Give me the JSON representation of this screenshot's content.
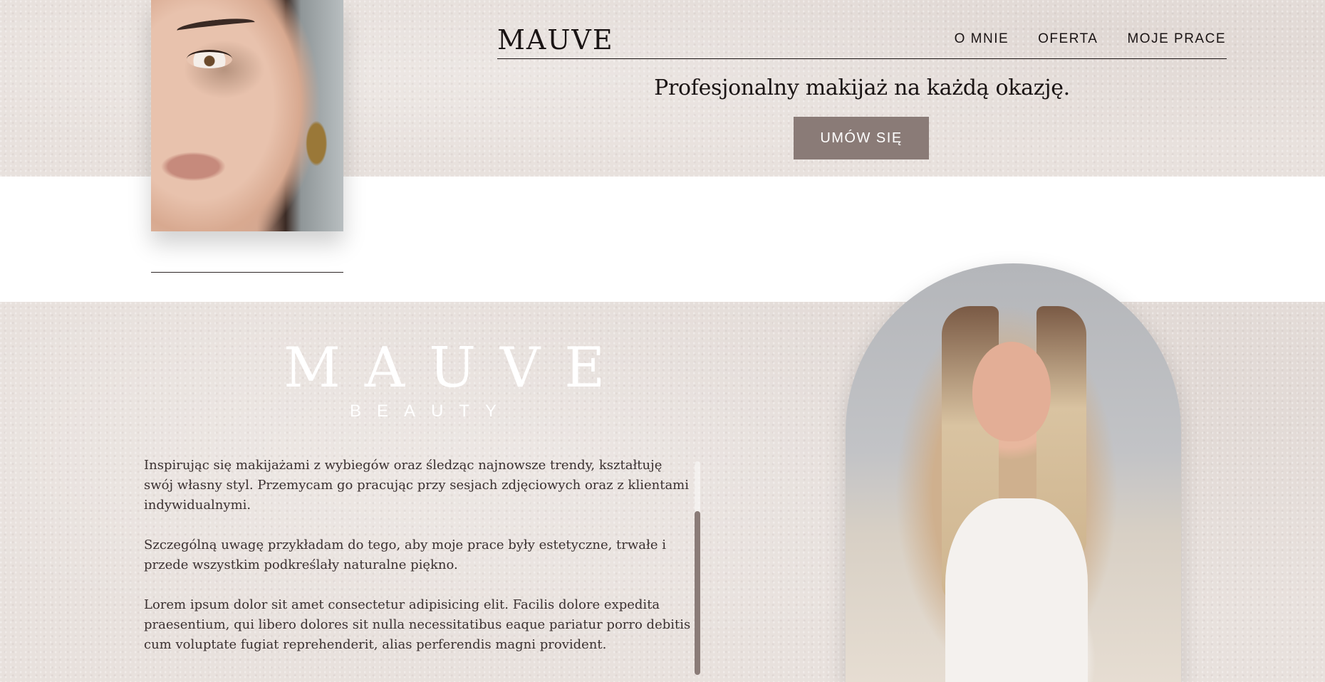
{
  "nav": {
    "logo": "MAUVE",
    "links": [
      "O MNIE",
      "OFERTA",
      "MOJE PRACE"
    ]
  },
  "hero": {
    "tagline": "Profesjonalny makijaż na każdą okazję.",
    "cta_label": "UMÓW SIĘ"
  },
  "about": {
    "logo": "MAUVE",
    "logo_sub": "BEAUTY",
    "paragraphs": [
      "Inspirując się makijażami z wybiegów oraz śledząc najnowsze trendy, kształtuję swój własny styl. Przemycam go pracując przy sesjach zdjęciowych oraz z klientami indywidualnymi.",
      "Szczególną uwagę przykładam do tego, aby moje prace były estetyczne, trwałe i przede wszystkim podkreślały naturalne piękno.",
      "Lorem ipsum dolor sit amet consectetur adipisicing elit. Facilis dolore expedita praesentium, qui libero dolores sit nulla necessitatibus eaque pariatur porro debitis cum voluptate fugiat reprehenderit, alias perferendis magni provident."
    ]
  },
  "colors": {
    "paper": "#e8e1dd",
    "accent": "#8a7b77",
    "text": "#1a1414"
  }
}
